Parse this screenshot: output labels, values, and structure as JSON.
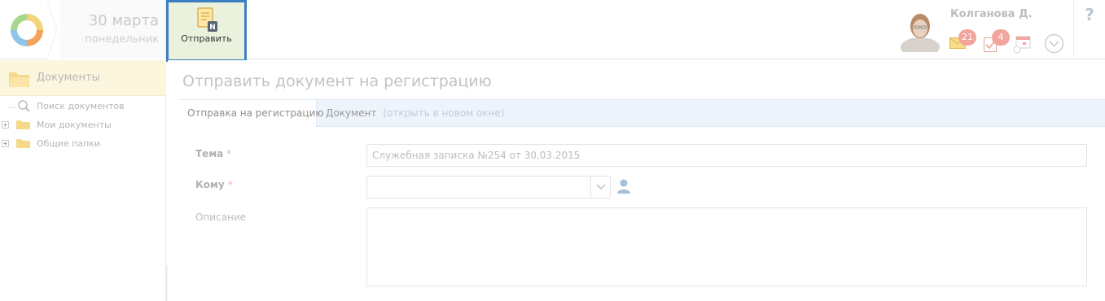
{
  "header": {
    "date_day": "30 марта",
    "date_weekday": "понедельник",
    "send_button_label": "Отправить",
    "user_name": "Колганова Д.",
    "mail_count": "21",
    "tasks_count": "4",
    "help_label": "?"
  },
  "sidebar": {
    "title": "Документы",
    "items": [
      {
        "label": "Поиск документов",
        "icon": "search-icon"
      },
      {
        "label": "Мои документы",
        "icon": "folder-icon"
      },
      {
        "label": "Общие папки",
        "icon": "folder-icon"
      }
    ]
  },
  "main": {
    "page_title": "Отправить документ на регистрацию",
    "tabs": [
      {
        "label": "Отправка на регистрацию"
      },
      {
        "label": "Документ",
        "hint": "(открыть в новом окне)"
      }
    ],
    "form": {
      "subject_label": "Тема",
      "subject_value": "Служебная записка №254 от 30.03.2015",
      "to_label": "Кому",
      "to_value": "",
      "description_label": "Описание",
      "description_value": "",
      "required_mark": "*"
    }
  },
  "colors": {
    "accent": "#3a7fc1",
    "send_button_bg": "#eaf2de",
    "sidebar_header_bg": "#fdf6df",
    "badge": "#f2a59c"
  }
}
